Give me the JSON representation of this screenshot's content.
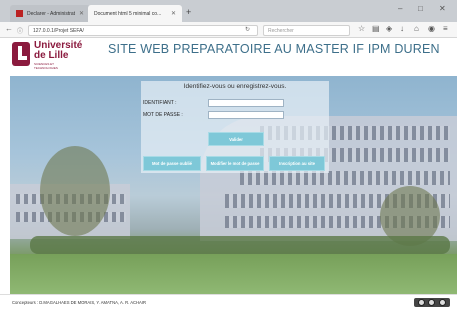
{
  "browser": {
    "tabs": [
      {
        "label": "Declarer - Administration"
      },
      {
        "label": "Document html 5 minimal co..."
      }
    ],
    "new_tab": "+",
    "window_controls": {
      "minimize": "–",
      "maximize": "□",
      "close": "✕"
    },
    "url": "127.0.0.1/Projet SEFA/",
    "search_placeholder": "Rechercher"
  },
  "site": {
    "logo_line1": "Université",
    "logo_line2": "de Lille",
    "logo_small1": "SCIENCES ET",
    "logo_small2": "TECHNOLOGIES",
    "title": "SITE WEB PREPARATOIRE AU MASTER IF IPM DUREN"
  },
  "login": {
    "title": "Identifiez-vous ou enregistrez-vous.",
    "identifiant_label": "IDENTIFIANT :",
    "password_label": "MOT DE PASSE :",
    "submit_label": "Valider",
    "forgot_label": "Mot de passe oublié",
    "change_label": "Modifier le mot de passe",
    "register_label": "Inscription au site"
  },
  "footer": {
    "credits": "Concepteurs : D.MAGALHAES DE MORAIS, Y. AMATNA, A. R. ACHAIR"
  },
  "colors": {
    "brand": "#8b1a3e",
    "title": "#3d6f8a",
    "button": "#7ec8d8"
  }
}
